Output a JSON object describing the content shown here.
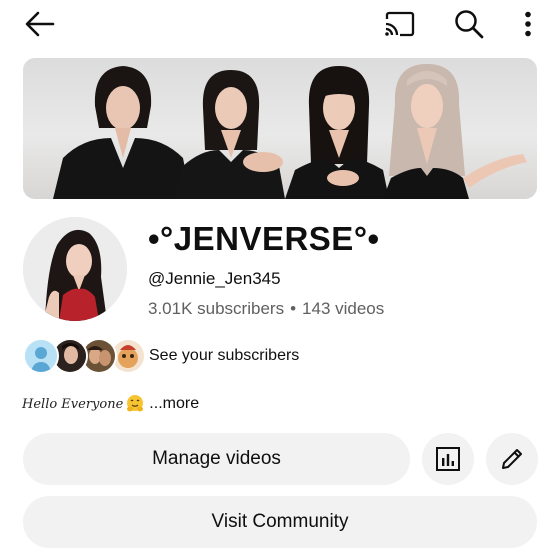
{
  "channel": {
    "name": "•°JENVERSE°•",
    "handle": "@Jennie_Jen345",
    "subscribers": "3.01K subscribers",
    "separator": "•",
    "videos": "143 videos"
  },
  "subscribers_row": {
    "label": "See your subscribers"
  },
  "description": {
    "script_text": "Hello Everyone",
    "more": "...more"
  },
  "buttons": {
    "manage_videos": "Manage videos",
    "visit_community": "Visit Community"
  },
  "icons": [
    "back-arrow-icon",
    "cast-icon",
    "search-icon",
    "more-vert-icon",
    "analytics-icon",
    "pencil-icon",
    "hugging-face-emoji"
  ]
}
